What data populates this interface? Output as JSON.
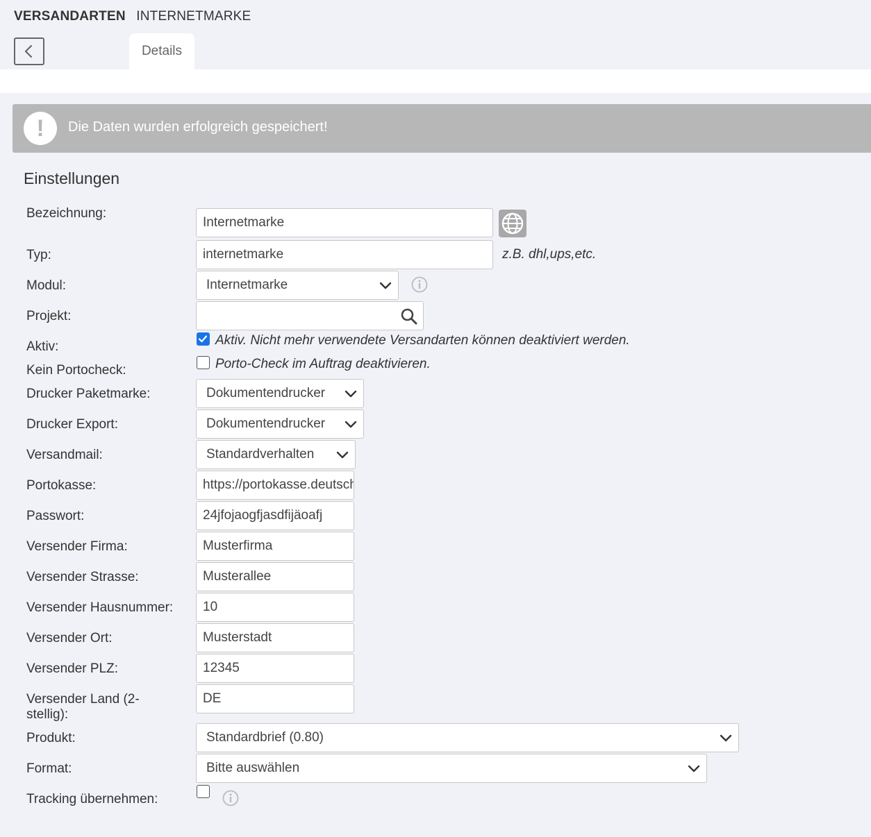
{
  "header": {
    "breadcrumb_bold": "VERSANDARTEN",
    "breadcrumb_current": "INTERNETMARKE",
    "tab_details": "Details"
  },
  "alert": {
    "message": "Die Daten wurden erfolgreich gespeichert!",
    "icon_text": "!"
  },
  "section_title": "Einstellungen",
  "form": {
    "bezeichnung": {
      "label": "Bezeichnung:",
      "value": "Internetmarke"
    },
    "typ": {
      "label": "Typ:",
      "value": "internetmarke",
      "hint": "z.B. dhl,ups,etc."
    },
    "modul": {
      "label": "Modul:",
      "value": "Internetmarke"
    },
    "projekt": {
      "label": "Projekt:",
      "value": ""
    },
    "aktiv": {
      "label": "Aktiv:",
      "checked": true,
      "text": "Aktiv. Nicht mehr verwendete Versandarten können deaktiviert werden."
    },
    "kein_portocheck": {
      "label": "Kein Portocheck:",
      "checked": false,
      "text": "Porto-Check im Auftrag deaktivieren."
    },
    "drucker_paketmarke": {
      "label": "Drucker Paketmarke:",
      "value": "Dokumentendrucker"
    },
    "drucker_export": {
      "label": "Drucker Export:",
      "value": "Dokumentendrucker"
    },
    "versandmail": {
      "label": "Versandmail:",
      "value": "Standardverhalten"
    },
    "portokasse": {
      "label": "Portokasse:",
      "value": "https://portokasse.deutschepost.de"
    },
    "passwort": {
      "label": "Passwort:",
      "value": "24jfojaogfjasdfijäoafj"
    },
    "versender_firma": {
      "label": "Versender Firma:",
      "value": "Musterfirma"
    },
    "versender_strasse": {
      "label": "Versender Strasse:",
      "value": "Musterallee"
    },
    "versender_hausnummer": {
      "label": "Versender Hausnummer:",
      "value": "10"
    },
    "versender_ort": {
      "label": "Versender Ort:",
      "value": "Musterstadt"
    },
    "versender_plz": {
      "label": "Versender PLZ:",
      "value": "12345"
    },
    "versender_land": {
      "label": "Versender Land (2-stellig):",
      "value": "DE"
    },
    "produkt": {
      "label": "Produkt:",
      "value": "Standardbrief (0.80)"
    },
    "format": {
      "label": "Format:",
      "value": "Bitte auswählen"
    },
    "tracking": {
      "label": "Tracking übernehmen:",
      "checked": false
    }
  }
}
